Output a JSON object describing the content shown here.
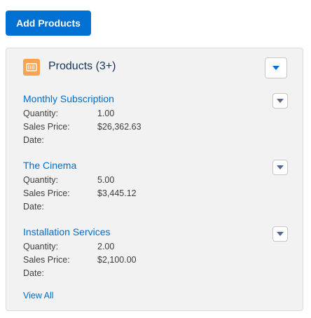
{
  "toolbar": {
    "add_products_label": "Add Products"
  },
  "card": {
    "title": "Products (3+)",
    "icon": "price-book-icon",
    "view_all_label": "View All",
    "field_labels": {
      "quantity": "Quantity:",
      "sales_price": "Sales Price:",
      "date": "Date:"
    },
    "products": [
      {
        "name": "Monthly Subscription",
        "quantity": "1.00",
        "sales_price": "$26,362.63",
        "date": ""
      },
      {
        "name": "The Cinema",
        "quantity": "5.00",
        "sales_price": "$3,445.12",
        "date": ""
      },
      {
        "name": "Installation Services",
        "quantity": "2.00",
        "sales_price": "$2,100.00",
        "date": ""
      }
    ]
  },
  "colors": {
    "brand": "#0070d2",
    "link": "#006dcc",
    "icon_bg": "#f7a452",
    "card_bg": "#f3f2f2"
  }
}
